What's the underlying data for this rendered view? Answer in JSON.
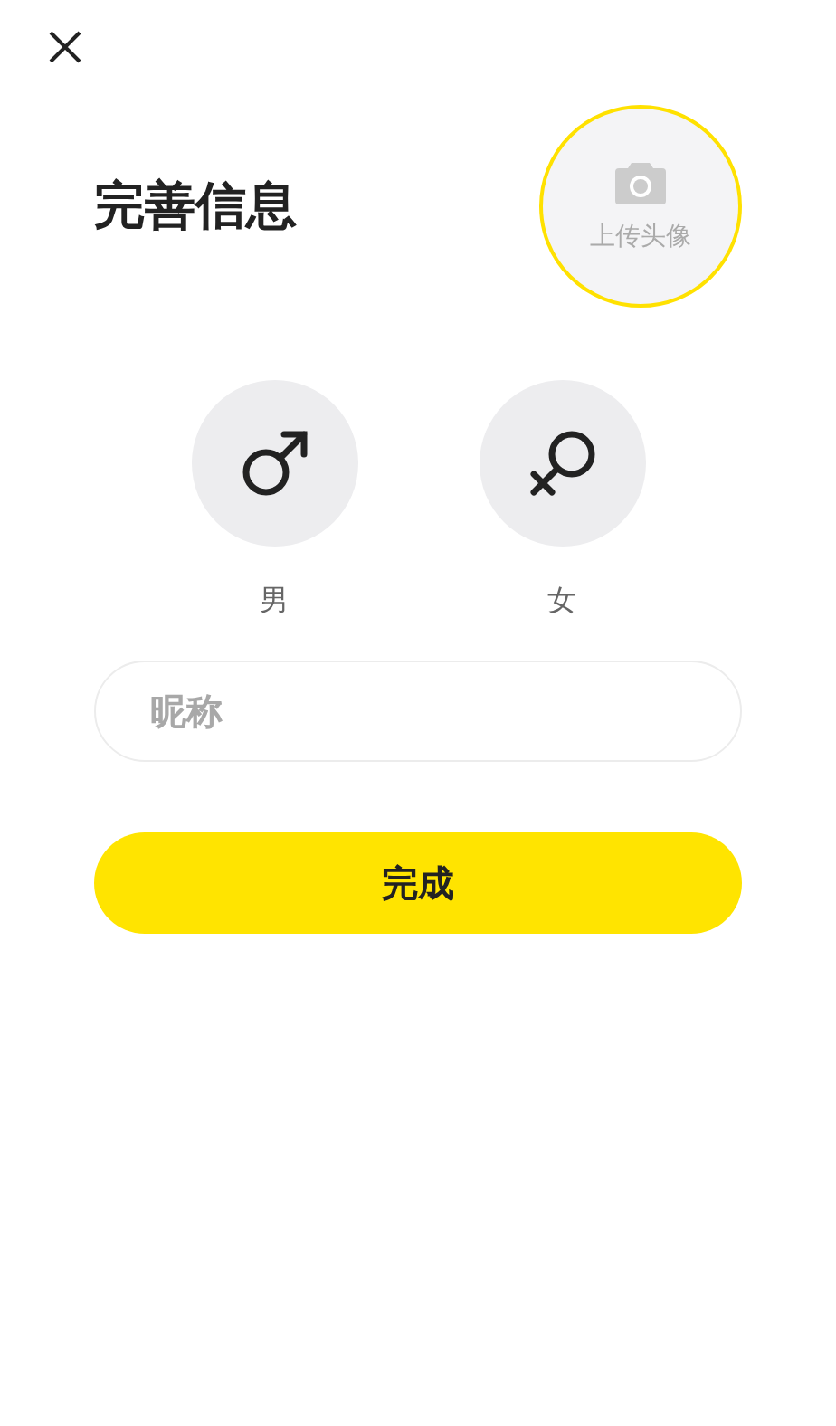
{
  "title": "完善信息",
  "avatar_upload": {
    "label": "上传头像"
  },
  "genders": [
    {
      "kind": "male",
      "label": "男",
      "selected": false
    },
    {
      "kind": "female",
      "label": "女",
      "selected": false
    }
  ],
  "nickname": {
    "placeholder": "昵称"
  },
  "submit_button": "完成"
}
